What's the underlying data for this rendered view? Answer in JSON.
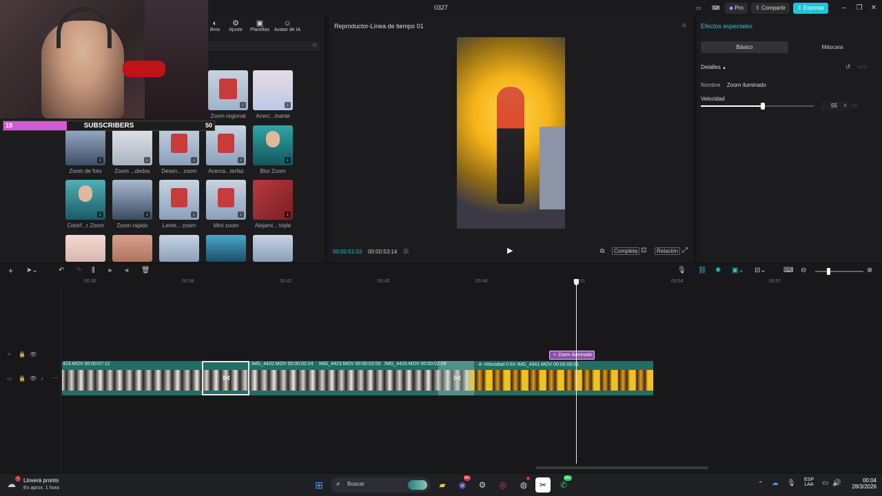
{
  "titlebar": {
    "title": "0327",
    "pro": "Pro",
    "share": "Compartir",
    "export": "Exportar"
  },
  "overlay": {
    "subscribers_label": "SUBSCRIBERS",
    "subscribers_current": "15",
    "subscribers_goal": "50",
    "subscribers_progress": 0.3
  },
  "toolbar": {
    "items": [
      {
        "label": "iltros"
      },
      {
        "label": "Ajuste"
      },
      {
        "label": "Plantillas"
      },
      {
        "label": "Avatar de IA"
      }
    ]
  },
  "effects": {
    "row1": [
      {
        "label": "Zoom regional"
      },
      {
        "label": "Acerc...mante"
      }
    ],
    "row2": [
      {
        "label": "Zoom de foto"
      },
      {
        "label": "Zoom ...dedos"
      },
      {
        "label": "Desen... zoom"
      },
      {
        "label": "Acerca...terfaz"
      },
      {
        "label": "Blur Zoom"
      }
    ],
    "row3": [
      {
        "label": "Colorf...r Zoom"
      },
      {
        "label": "Zoom rápido"
      },
      {
        "label": "Lente... zoom"
      },
      {
        "label": "Mini zoom"
      },
      {
        "label": "Alejami... triple"
      }
    ]
  },
  "player": {
    "title": "Reproductor-Línea de tiempo 01",
    "current_time": "00:00:51:03",
    "total_time": "00:00:53:14",
    "complete": "Completa",
    "ratio": "Relación"
  },
  "right_panel": {
    "title": "Efectos especiales",
    "tab_basic": "Básico",
    "tab_mask": "Máscara",
    "details": "Detalles",
    "name_label": "Nombre",
    "name_value": "Zoom iluminado",
    "speed_label": "Velocidad",
    "speed_value": "55",
    "speed_fraction": 0.55
  },
  "timeline": {
    "ruler": [
      "00:36",
      "00:39",
      "00:42",
      "00:45",
      "00:48",
      "00:51",
      "00:54",
      "00:57"
    ],
    "effect_clip": "Zoom iluminado",
    "clips": [
      {
        "label": "423.MOV  00:00:07:12"
      },
      {
        "label": "IMG_4420.MOV  00:00:02:24"
      },
      {
        "label": "IMG_4423.MOV  00:00:02:00"
      },
      {
        "label": "IMG_4420.MOV  00:00:02:09"
      },
      {
        "label": "Velocidad 0.6X   IMG_4341.MOV  00:00:06:01"
      }
    ]
  },
  "taskbar": {
    "weather_title": "Lloverá pronto",
    "weather_sub": "En aprox. 1 hora",
    "search": "Buscar",
    "lang1": "ESP",
    "lang2": "LAA",
    "time": "00:04",
    "date": "28/3/2026",
    "badge_discord": "99+",
    "badge_whatsapp": "99+"
  },
  "colors": {
    "accent": "#26c5d6",
    "export": "#1ec5d8",
    "subscribers": "#d25ccf",
    "effect_clip": "#8b4ea8",
    "track": "#1f6f66"
  }
}
